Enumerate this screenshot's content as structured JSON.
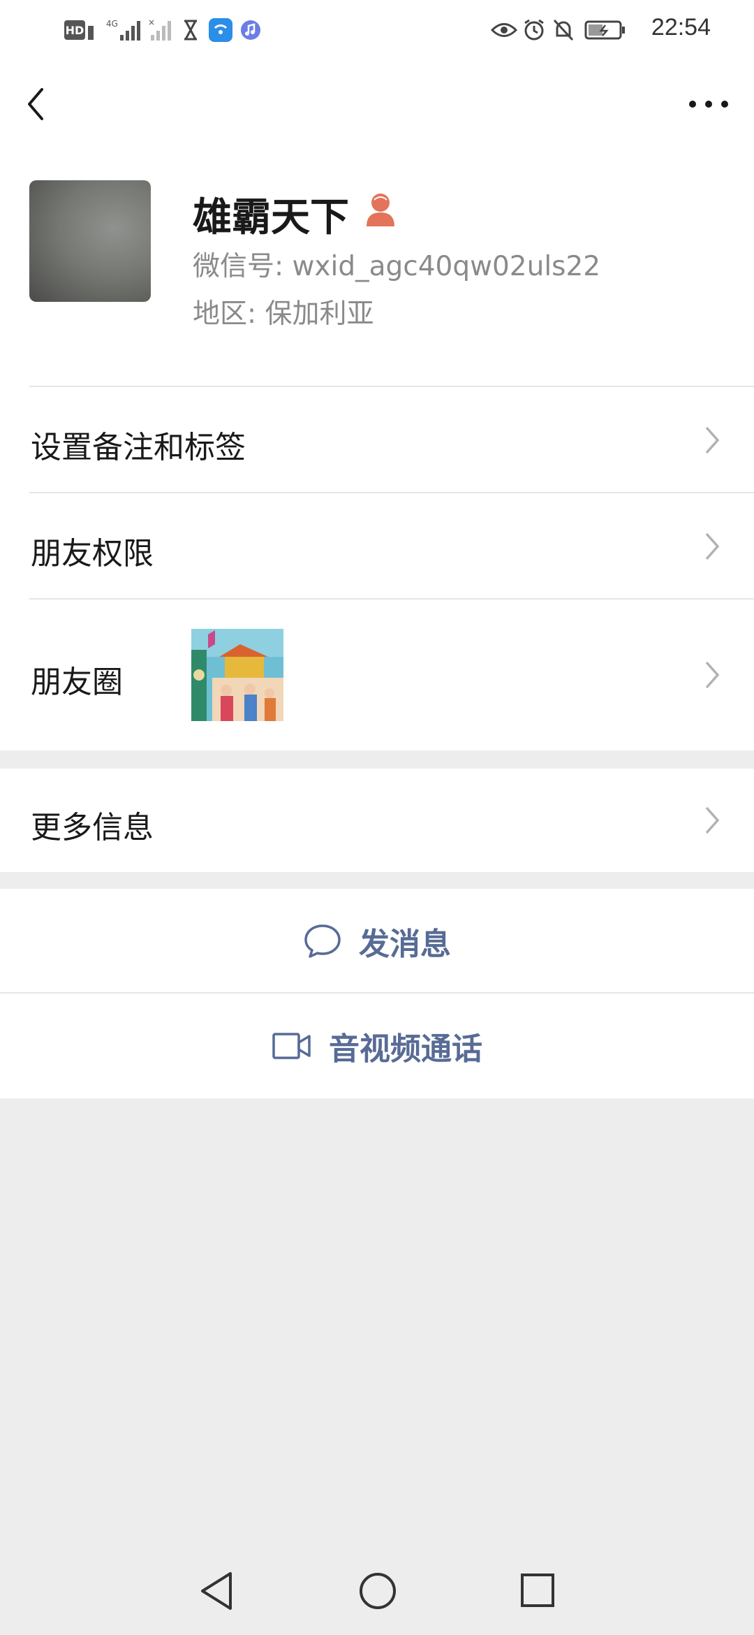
{
  "status_bar": {
    "time": "22:54",
    "left_icons": [
      "hd-icon",
      "signal-4g-icon",
      "signal-empty-icon",
      "hourglass-icon",
      "wifi-app-icon",
      "music-app-icon"
    ],
    "right_icons": [
      "eye-icon",
      "alarm-icon",
      "mute-icon",
      "battery-icon"
    ]
  },
  "nav": {
    "back_icon": "chevron-left-icon",
    "more_icon": "ellipsis-icon"
  },
  "profile": {
    "name": "雄霸天下",
    "gender_icon": "female-icon",
    "wechat_id": "微信号: wxid_agc40qw02uls22",
    "region": "地区: 保加利亚"
  },
  "rows": {
    "remark": "设置备注和标签",
    "permissions": "朋友权限",
    "moments": "朋友圈",
    "more_info": "更多信息"
  },
  "actions": {
    "message": "发消息",
    "video_call": "音视频通话"
  },
  "colors": {
    "accent": "#576b95",
    "background": "#ededed",
    "female": "#e3735a"
  }
}
